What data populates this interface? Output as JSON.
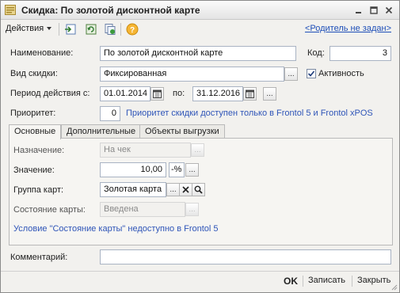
{
  "window": {
    "title": "Скидка: По золотой дисконтной карте"
  },
  "toolbar": {
    "actions_label": "Действия",
    "parent_link": "<Родитель не задан>"
  },
  "form": {
    "name_label": "Наименование:",
    "name_value": "По золотой дисконтной карте",
    "code_label": "Код:",
    "code_value": "3",
    "type_label": "Вид скидки:",
    "type_value": "Фиксированная",
    "active_label": "Активность",
    "active_checked": true,
    "period_label": "Период действия с:",
    "period_from": "01.01.2014",
    "period_to_label": "по:",
    "period_to": "31.12.2016",
    "priority_label": "Приоритет:",
    "priority_value": "0",
    "priority_note": "Приоритет скидки доступен только в Frontol 5 и Frontol xPOS",
    "comment_label": "Комментарий:",
    "comment_value": ""
  },
  "tabs": [
    {
      "label": "Основные",
      "active": true
    },
    {
      "label": "Дополнительные",
      "active": false
    },
    {
      "label": "Объекты выгрузки",
      "active": false
    }
  ],
  "main_tab": {
    "purpose_label": "Назначение:",
    "purpose_value": "На чек",
    "value_label": "Значение:",
    "value_amount": "10,00",
    "value_unit": "-%",
    "card_group_label": "Группа карт:",
    "card_group_value": "Золотая карта",
    "card_state_label": "Состояние карты:",
    "card_state_value": "Введена",
    "card_state_note": "Условие \"Состояние карты\" недоступно в Frontol 5"
  },
  "footer": {
    "ok_label": "OK",
    "save_label": "Записать",
    "close_label": "Закрыть"
  },
  "colors": {
    "link": "#1f4fb8",
    "note": "#2f55b8",
    "window_bg": "#f2f1ee"
  }
}
